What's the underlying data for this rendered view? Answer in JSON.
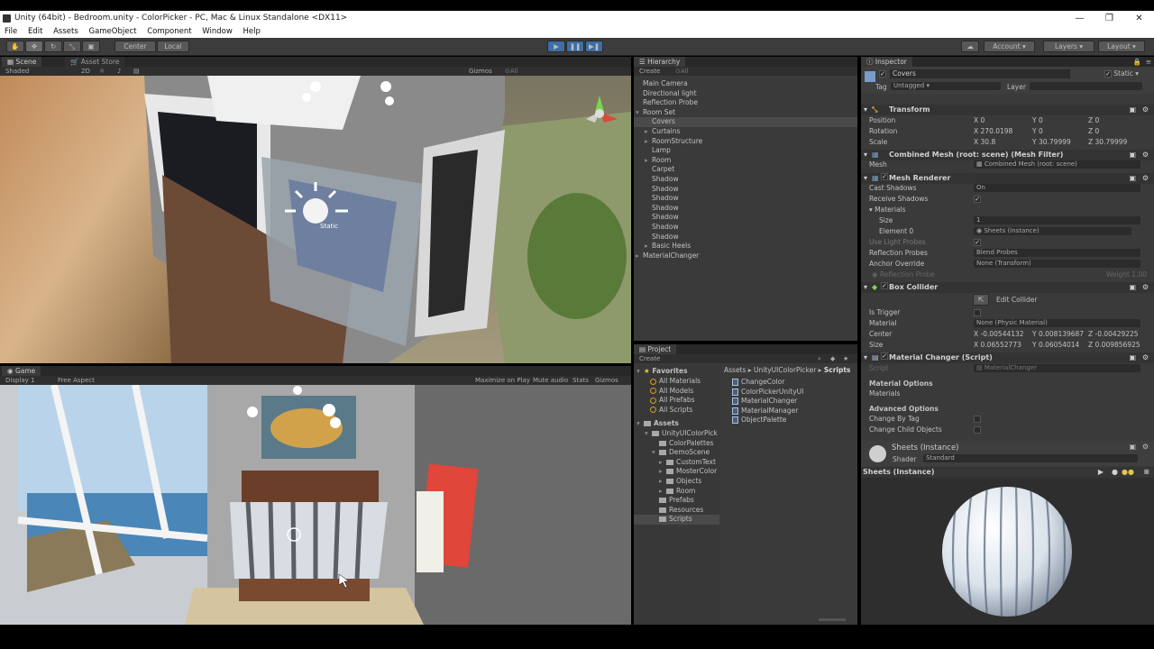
{
  "window": {
    "title": "Unity (64bit) - Bedroom.unity - ColorPicker - PC, Mac & Linux Standalone <DX11>"
  },
  "menu": [
    "File",
    "Edit",
    "Assets",
    "GameObject",
    "Component",
    "Window",
    "Help"
  ],
  "toolbar": {
    "center_label": "Center",
    "local_label": "Local",
    "account_label": "Account",
    "layers_label": "Layers",
    "layout_label": "Layout"
  },
  "scene": {
    "tab_scene": "Scene",
    "tab_asset_store": "Asset Store",
    "shading": "Shaded",
    "mode_2d": "2D",
    "gizmos": "Gizmos",
    "search": "⊙All",
    "static_label": "Static"
  },
  "game": {
    "tab": "Game",
    "display": "Display 1",
    "aspect": "Free Aspect",
    "maximize": "Maximize on Play",
    "mute": "Mute audio",
    "stats": "Stats",
    "gizmos": "Gizmos"
  },
  "hierarchy": {
    "tab": "Hierarchy",
    "create": "Create",
    "search": "⊙All",
    "items": [
      {
        "label": "Main Camera",
        "indent": 0,
        "arrow": ""
      },
      {
        "label": "Directional light",
        "indent": 0,
        "arrow": ""
      },
      {
        "label": "Reflection Probe",
        "indent": 0,
        "arrow": ""
      },
      {
        "label": "Room Set",
        "indent": 0,
        "arrow": "▾"
      },
      {
        "label": "Covers",
        "indent": 1,
        "arrow": "",
        "selected": true
      },
      {
        "label": "Curtains",
        "indent": 1,
        "arrow": "▸"
      },
      {
        "label": "RoomStructure",
        "indent": 1,
        "arrow": "▸"
      },
      {
        "label": "Lamp",
        "indent": 1,
        "arrow": ""
      },
      {
        "label": "Room",
        "indent": 1,
        "arrow": "▸"
      },
      {
        "label": "Carpet",
        "indent": 1,
        "arrow": ""
      },
      {
        "label": "Shadow",
        "indent": 1,
        "arrow": ""
      },
      {
        "label": "Shadow",
        "indent": 1,
        "arrow": ""
      },
      {
        "label": "Shadow",
        "indent": 1,
        "arrow": ""
      },
      {
        "label": "Shadow",
        "indent": 1,
        "arrow": ""
      },
      {
        "label": "Shadow",
        "indent": 1,
        "arrow": ""
      },
      {
        "label": "Shadow",
        "indent": 1,
        "arrow": ""
      },
      {
        "label": "Shadow",
        "indent": 1,
        "arrow": ""
      },
      {
        "label": "Basic Heels",
        "indent": 1,
        "arrow": "▸"
      },
      {
        "label": "MaterialChanger",
        "indent": 0,
        "arrow": "▸"
      }
    ]
  },
  "project": {
    "tab": "Project",
    "create": "Create",
    "breadcrumb": [
      "Assets",
      "UnityUIColorPicker",
      "Scripts"
    ],
    "favorites_label": "Favorites",
    "favorites": [
      "All Materials",
      "All Models",
      "All Prefabs",
      "All Scripts"
    ],
    "assets_label": "Assets",
    "tree": [
      {
        "label": "UnityUIColorPick",
        "indent": 1
      },
      {
        "label": "ColorPalettes",
        "indent": 2
      },
      {
        "label": "DemoScene",
        "indent": 2
      },
      {
        "label": "CustomText",
        "indent": 3
      },
      {
        "label": "MosterColor",
        "indent": 3
      },
      {
        "label": "Objects",
        "indent": 3
      },
      {
        "label": "Room",
        "indent": 3
      },
      {
        "label": "Prefabs",
        "indent": 2
      },
      {
        "label": "Resources",
        "indent": 2
      },
      {
        "label": "Scripts",
        "indent": 2,
        "selected": true
      }
    ],
    "files": [
      "ChangeColor",
      "ColorPickerUnityUI",
      "MaterialChanger",
      "MaterialManager",
      "ObjectPalette"
    ]
  },
  "inspector": {
    "tab": "Inspector",
    "object_name": "Covers",
    "static_label": "Static",
    "tag_label": "Tag",
    "tag_value": "Untagged",
    "layer_label": "Layer",
    "transform": {
      "title": "Transform",
      "position_label": "Position",
      "rotation_label": "Rotation",
      "scale_label": "Scale",
      "position": [
        "0",
        "0",
        "0"
      ],
      "rotation": [
        "270.0198",
        "0",
        "0"
      ],
      "scale": [
        "30.8",
        "30.79999",
        "30.79999"
      ]
    },
    "mesh_filter": {
      "title": "Combined Mesh (root: scene) (Mesh Filter)",
      "mesh_label": "Mesh",
      "mesh_value": "Combined Mesh (root: scene)"
    },
    "mesh_renderer": {
      "title": "Mesh Renderer",
      "cast_shadows_label": "Cast Shadows",
      "cast_shadows_value": "On",
      "receive_shadows_label": "Receive Shadows",
      "materials_label": "Materials",
      "size_label": "Size",
      "size_value": "1",
      "element0_label": "Element 0",
      "element0_value": "Sheets (Instance)",
      "light_probes_label": "Use Light Probes",
      "reflection_probes_label": "Reflection Probes",
      "reflection_probes_value": "Blend Probes",
      "anchor_label": "Anchor Override",
      "anchor_value": "None (Transform)",
      "probe_label": "Reflection Probe",
      "weight_label": "Weight 1.00"
    },
    "box_collider": {
      "title": "Box Collider",
      "edit_label": "Edit Collider",
      "trigger_label": "Is Trigger",
      "material_label": "Material",
      "material_value": "None (Physic Material)",
      "center_label": "Center",
      "size_label": "Size",
      "center": [
        "-0.00544132",
        "0.008139687",
        "-0.00429225"
      ],
      "size": [
        "0.06552773",
        "0.06054014",
        "0.009856925"
      ]
    },
    "script": {
      "title": "Material Changer (Script)",
      "script_label": "Script",
      "script_value": "MaterialChanger",
      "options_label": "Material Options",
      "materials_label": "Materials",
      "advanced_label": "Advanced Options",
      "change_tag_label": "Change By Tag",
      "change_child_label": "Change Child Objects"
    },
    "material": {
      "name": "Sheets (Instance)",
      "shader_label": "Shader",
      "shader_value": "Standard"
    },
    "preview": {
      "title": "Sheets (Instance)"
    }
  }
}
